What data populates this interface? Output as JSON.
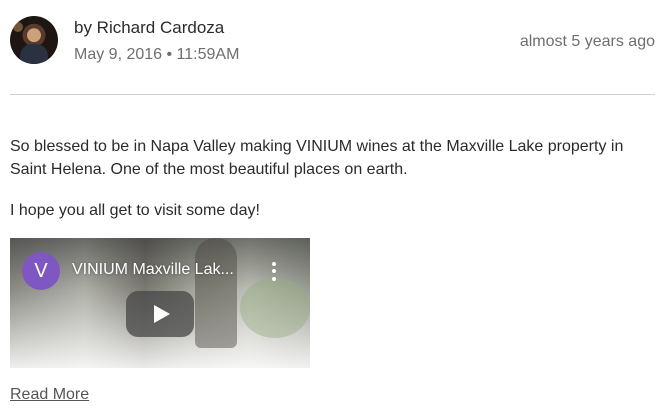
{
  "post": {
    "author": "by Richard Cardoza",
    "date": "May 9, 2016 • 11:59AM",
    "relative_time": "almost 5 years ago",
    "paragraphs": [
      "So blessed to be in Napa Valley making VINIUM wines at the Maxville Lake property in Saint Helena. One of the most beautiful places on earth.",
      "I hope you all get to visit some day!"
    ],
    "video": {
      "channel_initial": "V",
      "title": "VINIUM Maxville Lak...",
      "channel_color": "#7e57c2"
    },
    "read_more_label": "Read More"
  },
  "icons": [
    "avatar",
    "more-vert-icon",
    "play-icon"
  ]
}
